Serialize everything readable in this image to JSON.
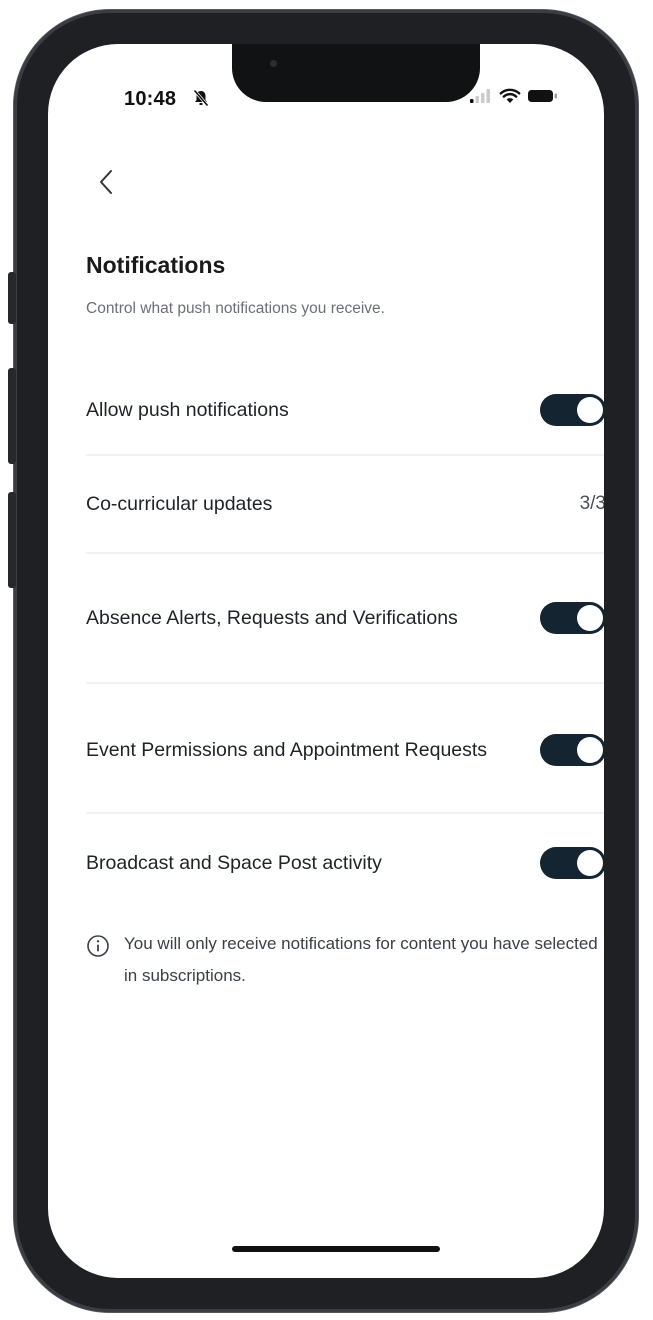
{
  "status_bar": {
    "time": "10:48",
    "icons": [
      "bell-off-icon",
      "signal-icon",
      "wifi-icon",
      "battery-icon"
    ]
  },
  "header": {
    "back_icon": "chevron-left-icon",
    "title": "Notifications",
    "subtitle": "Control what push notifications you receive."
  },
  "settings": [
    {
      "label": "Allow push notifications",
      "control": "toggle",
      "on": true
    },
    {
      "label": "Co-curricular updates",
      "control": "count",
      "value": "3/3"
    },
    {
      "label": "Absence Alerts, Requests and Verifications",
      "control": "toggle",
      "on": true
    },
    {
      "label": "Event Permissions and Appointment Requests",
      "control": "toggle",
      "on": true
    },
    {
      "label": "Broadcast and Space Post activity",
      "control": "toggle",
      "on": true
    }
  ],
  "info": {
    "icon": "info-icon",
    "text": "You will only receive notifications for content you have selected in subscriptions."
  },
  "colors": {
    "toggle_on": "#142430",
    "text_primary": "#1f2328",
    "text_secondary": "#6a6f78"
  }
}
